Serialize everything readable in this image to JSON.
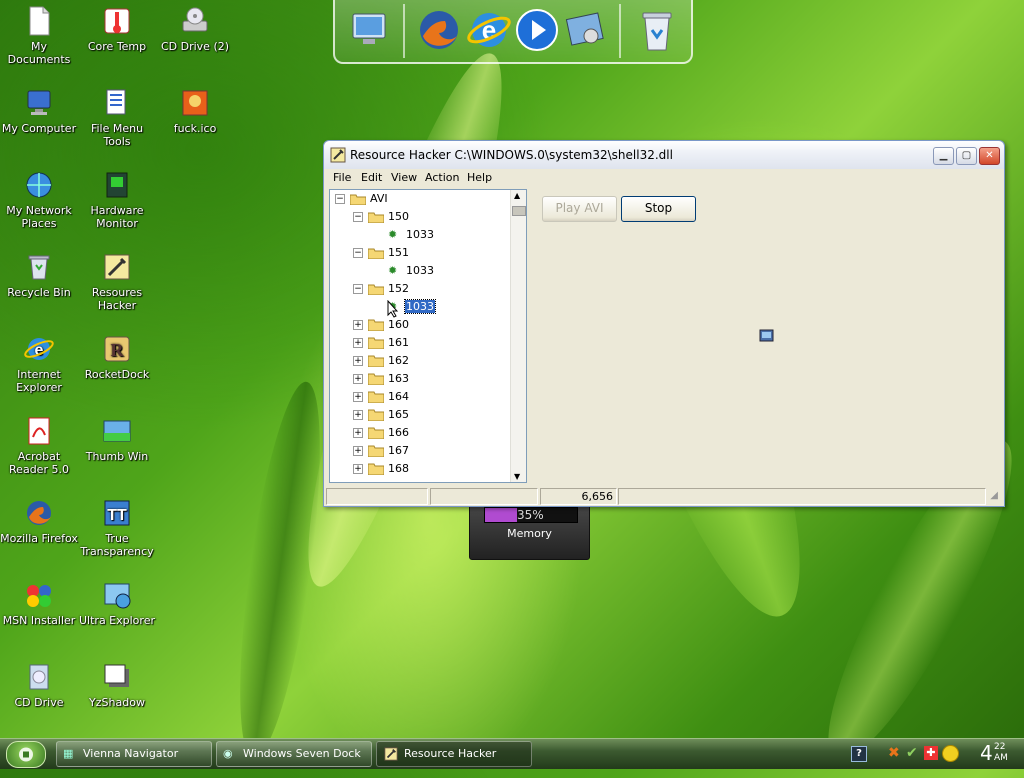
{
  "desktop": {
    "icons": [
      {
        "label": "My Documents"
      },
      {
        "label": "Core Temp"
      },
      {
        "label": "CD Drive (2)"
      },
      {
        "label": "My Computer"
      },
      {
        "label": "File Menu Tools"
      },
      {
        "label": "fuck.ico"
      },
      {
        "label": "My Network Places"
      },
      {
        "label": "Hardware Monitor"
      },
      {
        "label": "Recycle Bin"
      },
      {
        "label": "Resoures Hacker"
      },
      {
        "label": "Internet Explorer"
      },
      {
        "label": "RocketDock"
      },
      {
        "label": "Acrobat Reader 5.0"
      },
      {
        "label": "Thumb Win"
      },
      {
        "label": "Mozilla Firefox"
      },
      {
        "label": "True Transparency"
      },
      {
        "label": "MSN Installer"
      },
      {
        "label": "Ultra Explorer"
      },
      {
        "label": "CD Drive"
      },
      {
        "label": "YzShadow"
      }
    ]
  },
  "dock": {
    "items": [
      "my-computer-icon",
      "firefox-icon",
      "internet-explorer-icon",
      "media-player-icon",
      "control-panel-icon",
      "recycle-bin-icon"
    ]
  },
  "memory_gadget": {
    "percent_label": "35%",
    "percent_value": 35,
    "label": "Memory"
  },
  "window": {
    "title": "Resource Hacker   C:\\WINDOWS.0\\system32\\shell32.dll",
    "menu": [
      "File",
      "Edit",
      "View",
      "Action",
      "Help"
    ],
    "tree": {
      "root": "AVI",
      "items": [
        {
          "label": "150",
          "expanded": true,
          "child": "1033"
        },
        {
          "label": "151",
          "expanded": true,
          "child": "1033"
        },
        {
          "label": "152",
          "expanded": true,
          "child": "1033",
          "selected_child": true
        },
        {
          "label": "160"
        },
        {
          "label": "161"
        },
        {
          "label": "162"
        },
        {
          "label": "163"
        },
        {
          "label": "164"
        },
        {
          "label": "165"
        },
        {
          "label": "166"
        },
        {
          "label": "167"
        },
        {
          "label": "168"
        }
      ]
    },
    "buttons": {
      "play": "Play AVI",
      "stop": "Stop"
    },
    "status": {
      "panel1": "",
      "panel2": "",
      "panel3": "6,656",
      "panel4": ""
    }
  },
  "taskbar": {
    "tasks": [
      {
        "label": "Vienna Navigator",
        "active": false
      },
      {
        "label": "Windows Seven Dock",
        "active": false
      },
      {
        "label": "Resource Hacker",
        "active": true
      }
    ],
    "clock": {
      "hour": "4",
      "minutes": "22",
      "ampm": "AM"
    }
  },
  "colors": {
    "selection": "#316ac5",
    "titlebar_text": "#000000",
    "tree_border": "#7f9db9"
  }
}
